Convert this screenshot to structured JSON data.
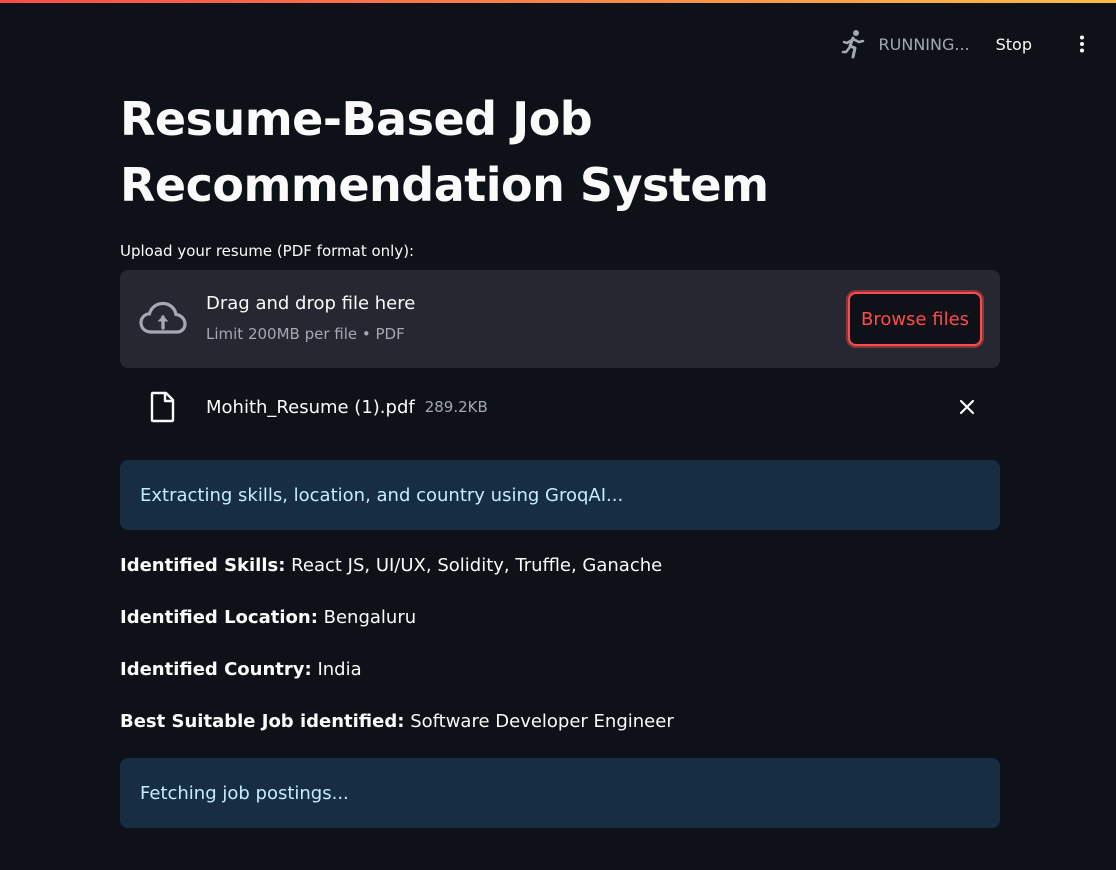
{
  "toolbar": {
    "status": "RUNNING...",
    "stop_label": "Stop"
  },
  "title": "Resume-Based Job Recommendation System",
  "uploader": {
    "label": "Upload your resume (PDF format only):",
    "drag_text": "Drag and drop file here",
    "limit_text": "Limit 200MB per file • PDF",
    "browse_label": "Browse files"
  },
  "file": {
    "name": "Mohith_Resume (1).pdf",
    "size": "289.2KB"
  },
  "info1": "Extracting skills, location, and country using GroqAI...",
  "results": {
    "skills_label": "Identified Skills:",
    "skills_value": "React JS, UI/UX, Solidity, Truffle, Ganache",
    "location_label": "Identified Location:",
    "location_value": "Bengaluru",
    "country_label": "Identified Country:",
    "country_value": "India",
    "job_label": "Best Suitable Job identified:",
    "job_value": "Software Developer Engineer"
  },
  "info2": "Fetching job postings...",
  "colors": {
    "background": "#0e1117",
    "accent": "#ff4b4b",
    "info_bg": "#172d43",
    "info_text": "#c7ebff"
  }
}
